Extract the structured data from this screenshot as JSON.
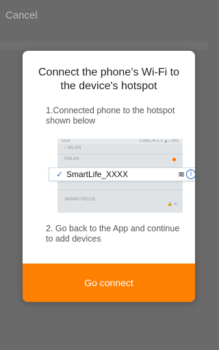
{
  "header": {
    "cancel_label": "Cancel"
  },
  "modal": {
    "title": "Connect the phone’s Wi-Fi to the device's hotspot",
    "step1": "1.Connected phone to the hotspot shown below",
    "step2": "2. Go back to the App and continue to add devices",
    "go_connect_label": "Go connect",
    "illustration": {
      "wlan_label": "WLAN",
      "selected_ssid": "SmartLife_XXXX",
      "status_left": "10:41",
      "status_right": "0.29K/s ⚑ ◴ ✦ ◢ ▭ 50%",
      "faint_rows": [
        "RWLAN",
        "",
        "",
        "",
        "360WiFi-FB321E"
      ],
      "icons": {
        "check": "check-icon",
        "wifi": "wifi-icon",
        "info": "info-icon",
        "lock": "lock-icon"
      }
    }
  },
  "colors": {
    "accent": "#ff7f00",
    "check_info_blue": "#2a66c7",
    "overlay": "#6a6a6a"
  }
}
